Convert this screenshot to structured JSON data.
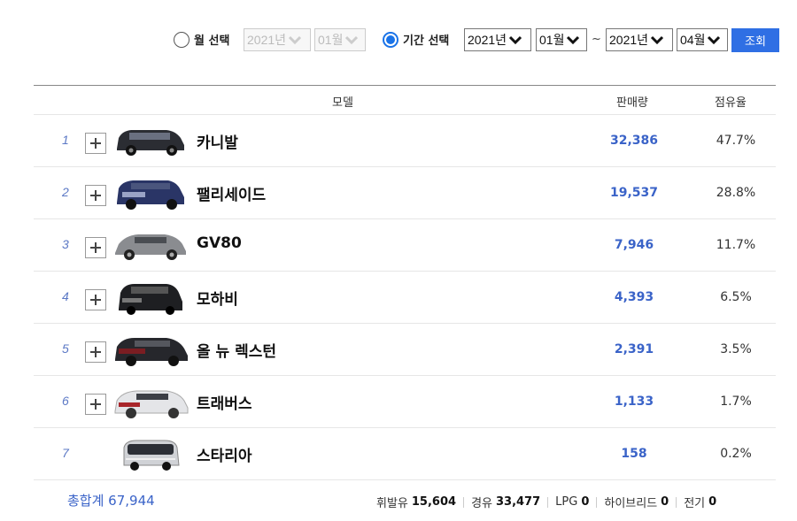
{
  "filter": {
    "month_label": "월 선택",
    "month_year": "2021년",
    "month_month": "01월",
    "period_label": "기간 선택",
    "from_year": "2021년",
    "from_month": "01월",
    "tilde": "~",
    "to_year": "2021년",
    "to_month": "04월",
    "query_button": "조회"
  },
  "table": {
    "headers": {
      "model": "모델",
      "sales": "판매량",
      "share": "점유율"
    },
    "rows": [
      {
        "rank": "1",
        "name": "카니발",
        "sales": "32,386",
        "share": "47.7%"
      },
      {
        "rank": "2",
        "name": "팰리세이드",
        "sales": "19,537",
        "share": "28.8%"
      },
      {
        "rank": "3",
        "name": "GV80",
        "sales": "7,946",
        "share": "11.7%"
      },
      {
        "rank": "4",
        "name": "모하비",
        "sales": "4,393",
        "share": "6.5%"
      },
      {
        "rank": "5",
        "name": "올 뉴 렉스턴",
        "sales": "2,391",
        "share": "3.5%"
      },
      {
        "rank": "6",
        "name": "트래버스",
        "sales": "1,133",
        "share": "1.7%"
      },
      {
        "rank": "7",
        "name": "스타리아",
        "sales": "158",
        "share": "0.2%"
      }
    ]
  },
  "footer": {
    "total": "총합계 67,944",
    "fuel": [
      {
        "label": "휘발유",
        "value": "15,604"
      },
      {
        "label": "경유",
        "value": "33,477"
      },
      {
        "label": "LPG",
        "value": "0"
      },
      {
        "label": "하이브리드",
        "value": "0"
      },
      {
        "label": "전기",
        "value": "0"
      }
    ]
  },
  "colors": {
    "accent": "#2f6fe4",
    "link": "#3a63c8",
    "radio": "#1a73e8"
  }
}
